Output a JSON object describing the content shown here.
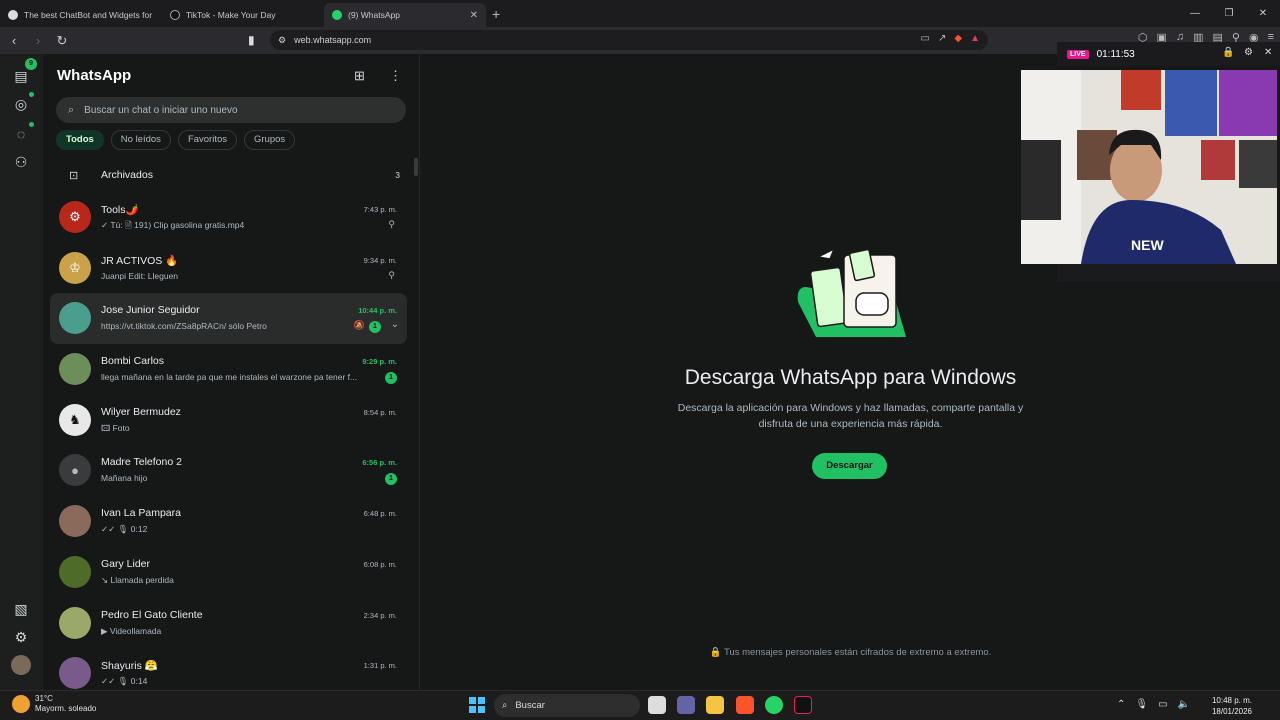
{
  "browser": {
    "tabs": [
      {
        "title": "The best ChatBot and Widgets for Ki",
        "icon": "bot-icon",
        "active": false
      },
      {
        "title": "TikTok - Make Your Day",
        "icon": "tiktok-icon",
        "active": false
      },
      {
        "title": "(9) WhatsApp",
        "icon": "whatsapp-icon",
        "active": true
      }
    ],
    "url": "web.whatsapp.com"
  },
  "rail": {
    "chats_badge": "9"
  },
  "sidebar": {
    "title": "WhatsApp",
    "search_placeholder": "Buscar un chat o iniciar uno nuevo",
    "filters": [
      "Todos",
      "No leídos",
      "Favoritos",
      "Grupos"
    ],
    "active_filter": "Todos",
    "archived": {
      "label": "Archivados",
      "count": "3"
    },
    "chats": [
      {
        "name": "Tools🌶️",
        "preview": "✓ Tú: 🗎 191) Clip gasolina gratis.mp4",
        "time": "7:43 p. m.",
        "pinned": true,
        "unread": "",
        "avatar_color": "#b8281a"
      },
      {
        "name": "JR ACTIVOS 🔥",
        "preview": "Juanpi Edit: Lleguen",
        "time": "9:34 p. m.",
        "pinned": true,
        "unread": "",
        "avatar_color": "#c9a24a"
      },
      {
        "name": "Jose Junior Seguidor",
        "preview": "https://vt.tiktok.com/ZSa8pRACn/ sólo Petro",
        "time": "10:44 p. m.",
        "pinned": false,
        "unread": "1",
        "muted": true,
        "avatar_color": "#4a9e8e"
      },
      {
        "name": "Bombi Carlos",
        "preview": "llega mañana en la tarde pa que me instales el warzone pa tener f...",
        "time": "9:29 p. m.",
        "pinned": false,
        "unread": "1",
        "avatar_color": "#6b8e5a"
      },
      {
        "name": "Wilyer Bermudez",
        "preview": "🖾 Foto",
        "time": "8:54 p. m.",
        "pinned": false,
        "unread": "",
        "avatar_color": "#e8e8e8"
      },
      {
        "name": "Madre Telefono 2",
        "preview": "Mañana hijo",
        "time": "6:56 p. m.",
        "pinned": false,
        "unread": "1",
        "avatar_color": "#3a3b3c"
      },
      {
        "name": "Ivan La Pampara",
        "preview": "✓✓ 🎙 0:12",
        "time": "6:48 p. m.",
        "pinned": false,
        "unread": "",
        "avatar_color": "#8a6a5a"
      },
      {
        "name": "Gary Lider",
        "preview": "↘ Llamada perdida",
        "time": "6:08 p. m.",
        "pinned": false,
        "unread": "",
        "avatar_color": "#4e6b2a"
      },
      {
        "name": "Pedro El Gato Cliente",
        "preview": "▶ Videollamada",
        "time": "2:34 p. m.",
        "pinned": false,
        "unread": "",
        "avatar_color": "#9aa86a"
      },
      {
        "name": "Shayuris 😤",
        "preview": "✓✓ 🎙 0:14",
        "time": "1:31 p. m.",
        "pinned": false,
        "unread": "",
        "avatar_color": "#7a5a8a"
      }
    ]
  },
  "intro": {
    "title": "Descarga WhatsApp para Windows",
    "subtitle": "Descarga la aplicación para Windows y haz llamadas, comparte pantalla y disfruta de una experiencia más rápida.",
    "button": "Descargar",
    "encrypted": "Tus mensajes personales están cifrados de extremo a extremo."
  },
  "overlay": {
    "live": "LIVE",
    "timer": "01:11:53"
  },
  "taskbar": {
    "temp": "31°C",
    "weather": "Mayorm. soleado",
    "search": "Buscar",
    "time": "10:48 p. m.",
    "date": "18/01/2026"
  }
}
